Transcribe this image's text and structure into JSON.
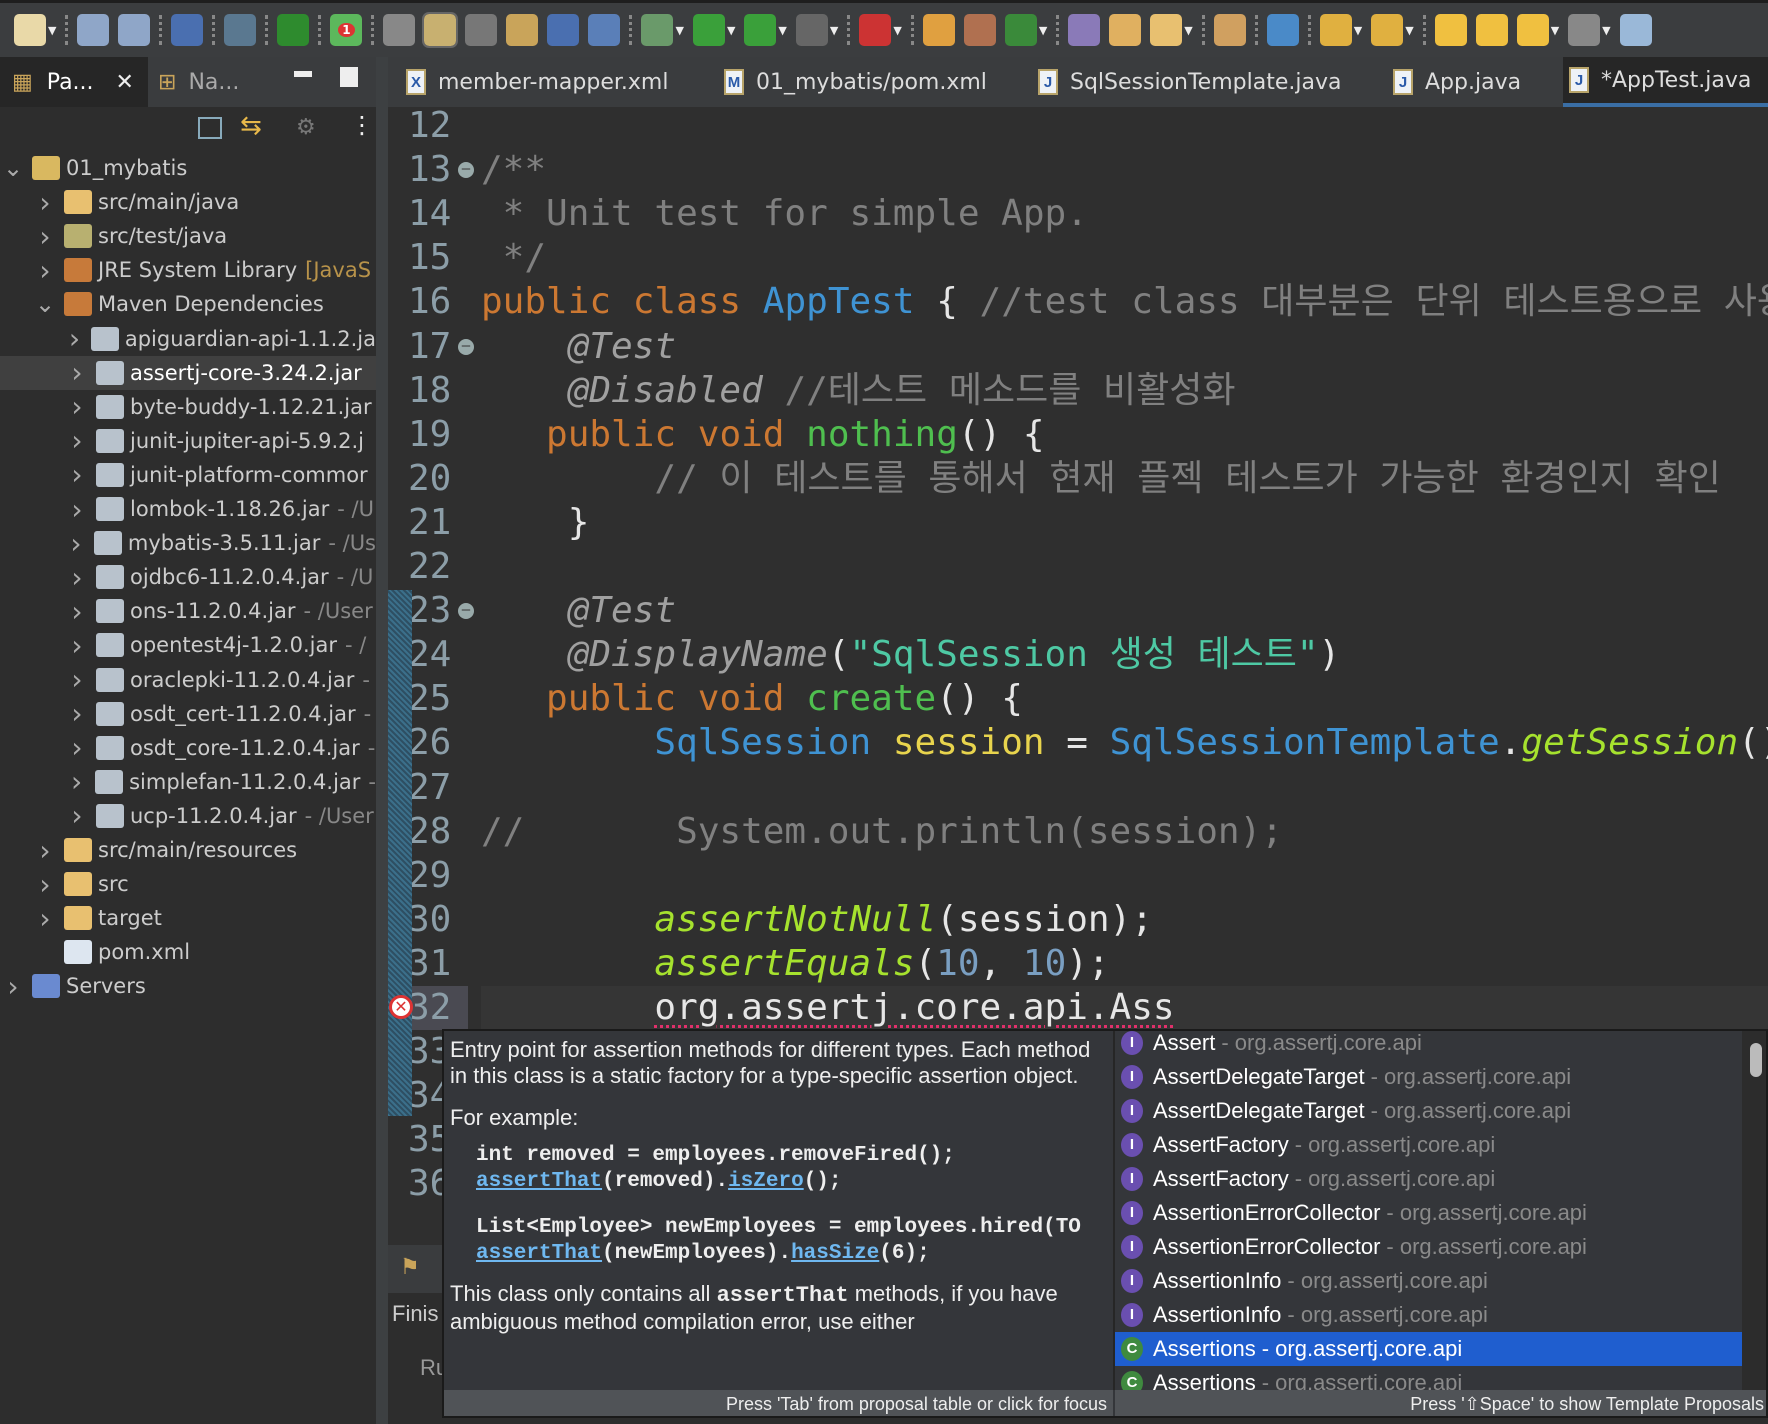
{
  "toolbar": {
    "icons": [
      "new-wizard-icon",
      "save-icon",
      "save-all-icon",
      "terminal-icon",
      "skip-breakpoints-icon",
      "spring-boot-icon",
      "spring-update-icon",
      "open-type-icon",
      "mark-occurrences-icon",
      "toggle-block-icon",
      "word-wrap-icon",
      "block-selection-icon",
      "whitespace-icon",
      "debug-icon",
      "run-icon",
      "coverage-icon",
      "stop-icon",
      "external-tools-icon",
      "new-java-project-icon",
      "new-package-icon",
      "new-class-icon",
      "open-task-icon",
      "open-folder-icon",
      "search-pencil-icon",
      "open-project-icon",
      "web-browser-icon",
      "next-annotation-icon",
      "previous-annotation-icon",
      "last-edit-icon",
      "forward-edit-icon",
      "back-icon",
      "forward-icon",
      "perspective-icon"
    ],
    "spring_badge": "1"
  },
  "left_panel": {
    "tabs": [
      {
        "label": "Pa...",
        "active": true
      },
      {
        "label": "Na..."
      }
    ],
    "tree": [
      {
        "label": "01_mybatis",
        "level": 0,
        "expanded": true,
        "icon": "project-icon"
      },
      {
        "label": "src/main/java",
        "level": 1,
        "icon": "source-folder-icon"
      },
      {
        "label": "src/test/java",
        "level": 1,
        "icon": "test-source-folder-icon"
      },
      {
        "label": "JRE System Library",
        "suffix": "[JavaS",
        "level": 1,
        "icon": "library-icon"
      },
      {
        "label": "Maven Dependencies",
        "level": 1,
        "expanded": true,
        "icon": "library-icon"
      },
      {
        "label": "apiguardian-api-1.1.2.ja",
        "level": 2,
        "icon": "jar-icon"
      },
      {
        "label": "assertj-core-3.24.2.jar",
        "level": 2,
        "icon": "jar-icon",
        "selected": true
      },
      {
        "label": "byte-buddy-1.12.21.jar",
        "level": 2,
        "icon": "jar-icon"
      },
      {
        "label": "junit-jupiter-api-5.9.2.j",
        "level": 2,
        "icon": "jar-icon"
      },
      {
        "label": "junit-platform-commor",
        "level": 2,
        "icon": "jar-icon"
      },
      {
        "label": "lombok-1.18.26.jar",
        "suffix": "- /U",
        "level": 2,
        "icon": "jar-icon"
      },
      {
        "label": "mybatis-3.5.11.jar",
        "suffix": "- /Us",
        "level": 2,
        "icon": "jar-icon"
      },
      {
        "label": "ojdbc6-11.2.0.4.jar",
        "suffix": "- /U",
        "level": 2,
        "icon": "jar-icon"
      },
      {
        "label": "ons-11.2.0.4.jar",
        "suffix": "- /User",
        "level": 2,
        "icon": "jar-icon"
      },
      {
        "label": "opentest4j-1.2.0.jar",
        "suffix": "- /",
        "level": 2,
        "icon": "jar-icon"
      },
      {
        "label": "oraclepki-11.2.0.4.jar",
        "suffix": "-",
        "level": 2,
        "icon": "jar-icon"
      },
      {
        "label": "osdt_cert-11.2.0.4.jar",
        "suffix": "-",
        "level": 2,
        "icon": "jar-icon"
      },
      {
        "label": "osdt_core-11.2.0.4.jar",
        "suffix": "-",
        "level": 2,
        "icon": "jar-icon"
      },
      {
        "label": "simplefan-11.2.0.4.jar",
        "suffix": "-",
        "level": 2,
        "icon": "jar-icon"
      },
      {
        "label": "ucp-11.2.0.4.jar",
        "suffix": "- /User",
        "level": 2,
        "icon": "jar-icon"
      },
      {
        "label": "src/main/resources",
        "level": 1,
        "icon": "source-folder-icon"
      },
      {
        "label": "src",
        "level": 1,
        "icon": "folder-icon"
      },
      {
        "label": "target",
        "level": 1,
        "icon": "folder-icon"
      },
      {
        "label": "pom.xml",
        "level": 1,
        "leaf": true,
        "icon": "maven-file-icon"
      },
      {
        "label": "Servers",
        "level": 0,
        "icon": "servers-folder-icon"
      }
    ]
  },
  "editor_tabs": [
    {
      "label": "member-mapper.xml",
      "icon": "X"
    },
    {
      "label": "01_mybatis/pom.xml",
      "icon": "M"
    },
    {
      "label": "SqlSessionTemplate.java",
      "icon": "J"
    },
    {
      "label": "App.java",
      "icon": "J"
    },
    {
      "label": "*AppTest.java",
      "icon": "J",
      "active": true
    }
  ],
  "code": [
    {
      "n": "12",
      "t": []
    },
    {
      "n": "13",
      "fold": true,
      "t": [
        [
          "/**",
          "cm"
        ]
      ]
    },
    {
      "n": "14",
      "t": [
        [
          " * Unit test for simple App.",
          "cm"
        ]
      ]
    },
    {
      "n": "15",
      "t": [
        [
          " */",
          "cm"
        ]
      ]
    },
    {
      "n": "16",
      "t": [
        [
          "public",
          "kw"
        ],
        [
          " ",
          ""
        ],
        [
          "class",
          "kw"
        ],
        [
          " ",
          ""
        ],
        [
          "AppTest",
          "cls"
        ],
        [
          " { ",
          ""
        ],
        [
          "//test class 대부분은 단위 테스트용으로 사용하",
          "cm"
        ]
      ]
    },
    {
      "n": "17",
      "fold": true,
      "t": [
        [
          "    ",
          ""
        ],
        [
          "@Test",
          "ann"
        ]
      ]
    },
    {
      "n": "18",
      "t": [
        [
          "    ",
          ""
        ],
        [
          "@Disabled",
          "ann"
        ],
        [
          " //테스트 메소드를 비활성화",
          "cm"
        ]
      ]
    },
    {
      "n": "19",
      "t": [
        [
          "   ",
          ""
        ],
        [
          "public",
          "kw"
        ],
        [
          " ",
          ""
        ],
        [
          "void",
          "kw"
        ],
        [
          " ",
          ""
        ],
        [
          "nothing",
          "md"
        ],
        [
          "() {",
          ""
        ]
      ]
    },
    {
      "n": "20",
      "t": [
        [
          "        ",
          ""
        ],
        [
          "// 이 테스트를 통해서 현재 플젝 테스트가 가능한 환경인지 확인",
          "cm"
        ]
      ]
    },
    {
      "n": "21",
      "t": [
        [
          "    }",
          ""
        ]
      ]
    },
    {
      "n": "22",
      "t": []
    },
    {
      "n": "23",
      "fold": true,
      "t": [
        [
          "    ",
          ""
        ],
        [
          "@Test",
          "ann"
        ]
      ]
    },
    {
      "n": "24",
      "t": [
        [
          "    ",
          ""
        ],
        [
          "@DisplayName",
          "ann"
        ],
        [
          "(",
          ""
        ],
        [
          "\"SqlSession 생성 테스트\"",
          "str"
        ],
        [
          ")",
          ""
        ]
      ]
    },
    {
      "n": "25",
      "t": [
        [
          "   ",
          ""
        ],
        [
          "public",
          "kw"
        ],
        [
          " ",
          ""
        ],
        [
          "void",
          "kw"
        ],
        [
          " ",
          ""
        ],
        [
          "create",
          "md"
        ],
        [
          "() {",
          ""
        ]
      ]
    },
    {
      "n": "26",
      "t": [
        [
          "        ",
          ""
        ],
        [
          "SqlSession",
          "cls"
        ],
        [
          " ",
          ""
        ],
        [
          "session",
          "var"
        ],
        [
          " = ",
          ""
        ],
        [
          "SqlSessionTemplate",
          "cls"
        ],
        [
          ".",
          ""
        ],
        [
          "getSession",
          "sm"
        ],
        [
          "()",
          ""
        ]
      ]
    },
    {
      "n": "27",
      "t": []
    },
    {
      "n": "28",
      "t": [
        [
          "//       System.out.println(session);",
          "cm"
        ]
      ]
    },
    {
      "n": "29",
      "t": []
    },
    {
      "n": "30",
      "t": [
        [
          "        ",
          ""
        ],
        [
          "assertNotNull",
          "sm"
        ],
        [
          "(session);",
          ""
        ]
      ]
    },
    {
      "n": "31",
      "t": [
        [
          "        ",
          ""
        ],
        [
          "assertEquals",
          "sm"
        ],
        [
          "(",
          ""
        ],
        [
          "10",
          "num"
        ],
        [
          ", ",
          ""
        ],
        [
          "10",
          "num"
        ],
        [
          ");",
          ""
        ]
      ]
    },
    {
      "n": "32",
      "current": true,
      "error": true,
      "t": [
        [
          "        ",
          ""
        ],
        [
          "org.assertj.core.api.Ass",
          "err"
        ]
      ]
    },
    {
      "n": "33",
      "t": []
    },
    {
      "n": "34",
      "t": []
    },
    {
      "n": "35",
      "t": []
    },
    {
      "n": "36",
      "t": []
    }
  ],
  "bottom_panel": {
    "row1": "Finis",
    "row2": "Ru"
  },
  "popup": {
    "doc": {
      "p1": "Entry point for assertion methods for different types. Each method in this class is a static factory for a type-specific assertion object.",
      "p2": "For example:",
      "ex1_line1": "int removed = employees.removeFired();",
      "ex1_link1": "assertThat",
      "ex1_mid": "(removed).",
      "ex1_link2": "isZero",
      "ex1_end": "();",
      "ex2_line1": "List<Employee> newEmployees = employees.hired(TO",
      "ex2_link1": "assertThat",
      "ex2_mid": "(newEmployees).",
      "ex2_link2": "hasSize",
      "ex2_end": "(6);",
      "p3_a": "This class only contains all ",
      "p3_code": "assertThat",
      "p3_b": " methods, if you have ambiguous method compilation error, use either",
      "footer": "Press 'Tab' from proposal table or click for focus"
    },
    "proposals": [
      {
        "kind": "I",
        "name": "Assert",
        "pkg": "- org.assertj.core.api"
      },
      {
        "kind": "I",
        "name": "AssertDelegateTarget",
        "pkg": "- org.assertj.core.api"
      },
      {
        "kind": "I",
        "name": "AssertDelegateTarget",
        "pkg": "- org.assertj.core.api"
      },
      {
        "kind": "I",
        "name": "AssertFactory",
        "pkg": "- org.assertj.core.api"
      },
      {
        "kind": "I",
        "name": "AssertFactory",
        "pkg": "- org.assertj.core.api"
      },
      {
        "kind": "I",
        "name": "AssertionErrorCollector",
        "pkg": "- org.assertj.core.api"
      },
      {
        "kind": "I",
        "name": "AssertionErrorCollector",
        "pkg": "- org.assertj.core.api"
      },
      {
        "kind": "I",
        "name": "AssertionInfo",
        "pkg": "- org.assertj.core.api"
      },
      {
        "kind": "I",
        "name": "AssertionInfo",
        "pkg": "- org.assertj.core.api"
      },
      {
        "kind": "C",
        "name": "Assertions",
        "pkg": "- org.assertj.core.api",
        "selected": true
      },
      {
        "kind": "C",
        "name": "Assertions",
        "pkg": "- org.assertj.core.api"
      }
    ],
    "list_footer": "Press '⇧Space' to show Template Proposals"
  },
  "colors": {
    "selection": "#1f5ecf",
    "keyword": "#cc7832",
    "type": "#3f93d3",
    "error_underline": "#e0306a"
  }
}
